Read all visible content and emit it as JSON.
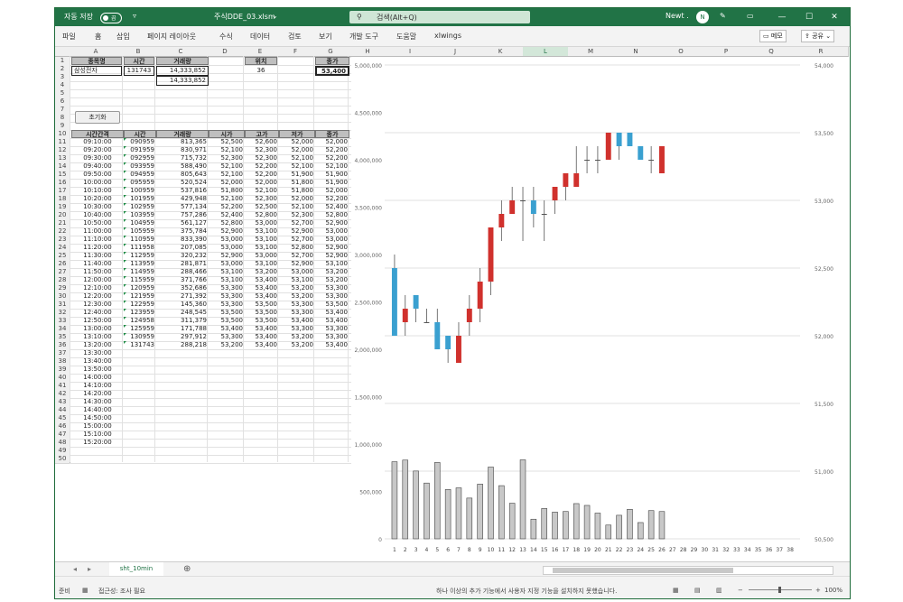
{
  "titlebar": {
    "autosave_label": "자동 저장",
    "autosave_state": "끔",
    "quick_access": "▿",
    "filename": "주식DDE_03.xlsm",
    "search_placeholder": "검색(Alt+Q)",
    "user_name": "Newt .",
    "user_initial": "N",
    "minimize": "—",
    "maximize": "☐",
    "close": "✕"
  },
  "ribbon": {
    "tabs": [
      "파일",
      "홈",
      "삽입",
      "페이지 레이아웃",
      "수식",
      "데이터",
      "검토",
      "보기",
      "개발 도구",
      "도움말",
      "xlwings"
    ],
    "memo": "메모",
    "share": "공유"
  },
  "columns": [
    "A",
    "B",
    "C",
    "D",
    "E",
    "F",
    "G",
    "H",
    "I",
    "J",
    "K",
    "L",
    "M",
    "N",
    "O",
    "P",
    "Q",
    "R"
  ],
  "selected_column": "L",
  "rows": {
    "numbers": [
      1,
      2,
      3,
      4,
      5,
      6,
      7,
      8,
      9,
      10,
      11,
      12,
      13,
      14,
      15,
      16,
      17,
      18,
      19,
      20,
      21,
      22,
      23,
      24,
      25,
      26,
      27,
      28,
      29,
      30,
      31,
      32,
      33,
      34,
      35,
      36,
      37,
      38,
      39,
      40,
      41,
      42,
      43,
      44,
      45,
      46,
      47,
      48,
      49,
      50
    ]
  },
  "top_section": {
    "headers": [
      "종목명",
      "시간",
      "거래량"
    ],
    "stock_name": "삼성전자",
    "time": "131743",
    "volume": "14,333,852",
    "volume2": "14,333,852",
    "position_label": "위치",
    "position_value": "36",
    "close_label": "종가",
    "close_value": "53,400"
  },
  "reset_button": "초기화",
  "table": {
    "headers": [
      "시간간격",
      "시간",
      "거래량",
      "시가",
      "고가",
      "저가",
      "종가"
    ],
    "rows": [
      [
        "09:10:00",
        "090959",
        "813,365",
        "52,500",
        "52,600",
        "52,000",
        "52,000"
      ],
      [
        "09:20:00",
        "091959",
        "830,971",
        "52,100",
        "52,300",
        "52,000",
        "52,200"
      ],
      [
        "09:30:00",
        "092959",
        "715,732",
        "52,300",
        "52,300",
        "52,100",
        "52,200"
      ],
      [
        "09:40:00",
        "093959",
        "588,490",
        "52,100",
        "52,200",
        "52,100",
        "52,100"
      ],
      [
        "09:50:00",
        "094959",
        "805,643",
        "52,100",
        "52,200",
        "51,900",
        "51,900"
      ],
      [
        "10:00:00",
        "095959",
        "520,524",
        "52,000",
        "52,000",
        "51,800",
        "51,900"
      ],
      [
        "10:10:00",
        "100959",
        "537,816",
        "51,800",
        "52,100",
        "51,800",
        "52,000"
      ],
      [
        "10:20:00",
        "101959",
        "429,948",
        "52,100",
        "52,300",
        "52,000",
        "52,200"
      ],
      [
        "10:30:00",
        "102959",
        "577,134",
        "52,200",
        "52,500",
        "52,100",
        "52,400"
      ],
      [
        "10:40:00",
        "103959",
        "757,286",
        "52,400",
        "52,800",
        "52,300",
        "52,800"
      ],
      [
        "10:50:00",
        "104959",
        "561,127",
        "52,800",
        "53,000",
        "52,700",
        "52,900"
      ],
      [
        "11:00:00",
        "105959",
        "375,784",
        "52,900",
        "53,100",
        "52,900",
        "53,000"
      ],
      [
        "11:10:00",
        "110959",
        "833,390",
        "53,000",
        "53,100",
        "52,700",
        "53,000"
      ],
      [
        "11:20:00",
        "111958",
        "207,085",
        "53,000",
        "53,100",
        "52,800",
        "52,900"
      ],
      [
        "11:30:00",
        "112959",
        "320,232",
        "52,900",
        "53,000",
        "52,700",
        "52,900"
      ],
      [
        "11:40:00",
        "113959",
        "281,871",
        "53,000",
        "53,100",
        "52,900",
        "53,100"
      ],
      [
        "11:50:00",
        "114959",
        "288,466",
        "53,100",
        "53,200",
        "53,000",
        "53,200"
      ],
      [
        "12:00:00",
        "115959",
        "371,766",
        "53,100",
        "53,400",
        "53,100",
        "53,200"
      ],
      [
        "12:10:00",
        "120959",
        "352,686",
        "53,300",
        "53,400",
        "53,200",
        "53,300"
      ],
      [
        "12:20:00",
        "121959",
        "271,392",
        "53,300",
        "53,400",
        "53,200",
        "53,300"
      ],
      [
        "12:30:00",
        "122959",
        "145,360",
        "53,300",
        "53,500",
        "53,300",
        "53,500"
      ],
      [
        "12:40:00",
        "123959",
        "248,545",
        "53,500",
        "53,500",
        "53,300",
        "53,400"
      ],
      [
        "12:50:00",
        "124958",
        "311,379",
        "53,500",
        "53,500",
        "53,400",
        "53,400"
      ],
      [
        "13:00:00",
        "125959",
        "171,788",
        "53,400",
        "53,400",
        "53,300",
        "53,300"
      ],
      [
        "13:10:00",
        "130959",
        "297,912",
        "53,300",
        "53,400",
        "53,200",
        "53,300"
      ],
      [
        "13:20:00",
        "131743",
        "288,218",
        "53,200",
        "53,400",
        "53,200",
        "53,400"
      ]
    ],
    "empty_times": [
      "13:30:00",
      "13:40:00",
      "13:50:00",
      "14:00:00",
      "14:10:00",
      "14:20:00",
      "14:30:00",
      "14:40:00",
      "14:50:00",
      "15:00:00",
      "15:10:00",
      "15:20:00"
    ]
  },
  "chart_data": {
    "type": "bar",
    "categories": [
      "1",
      "2",
      "3",
      "4",
      "5",
      "6",
      "7",
      "8",
      "9",
      "10",
      "11",
      "12",
      "13",
      "14",
      "15",
      "16",
      "17",
      "18",
      "19",
      "20",
      "21",
      "22",
      "23",
      "24",
      "25",
      "26",
      "27",
      "28",
      "29",
      "30",
      "31",
      "32",
      "33",
      "34",
      "35",
      "36",
      "37",
      "38"
    ],
    "candles": [
      {
        "open": 52500,
        "high": 52600,
        "low": 52000,
        "close": 52000
      },
      {
        "open": 52100,
        "high": 52300,
        "low": 52000,
        "close": 52200
      },
      {
        "open": 52300,
        "high": 52300,
        "low": 52100,
        "close": 52200
      },
      {
        "open": 52100,
        "high": 52200,
        "low": 52100,
        "close": 52100
      },
      {
        "open": 52100,
        "high": 52200,
        "low": 51900,
        "close": 51900
      },
      {
        "open": 52000,
        "high": 52000,
        "low": 51800,
        "close": 51900
      },
      {
        "open": 51800,
        "high": 52100,
        "low": 51800,
        "close": 52000
      },
      {
        "open": 52100,
        "high": 52300,
        "low": 52000,
        "close": 52200
      },
      {
        "open": 52200,
        "high": 52500,
        "low": 52100,
        "close": 52400
      },
      {
        "open": 52400,
        "high": 52800,
        "low": 52300,
        "close": 52800
      },
      {
        "open": 52800,
        "high": 53000,
        "low": 52700,
        "close": 52900
      },
      {
        "open": 52900,
        "high": 53100,
        "low": 52900,
        "close": 53000
      },
      {
        "open": 53000,
        "high": 53100,
        "low": 52700,
        "close": 53000
      },
      {
        "open": 53000,
        "high": 53100,
        "low": 52800,
        "close": 52900
      },
      {
        "open": 52900,
        "high": 53000,
        "low": 52700,
        "close": 52900
      },
      {
        "open": 53000,
        "high": 53100,
        "low": 52900,
        "close": 53100
      },
      {
        "open": 53100,
        "high": 53200,
        "low": 53000,
        "close": 53200
      },
      {
        "open": 53100,
        "high": 53400,
        "low": 53100,
        "close": 53200
      },
      {
        "open": 53300,
        "high": 53400,
        "low": 53200,
        "close": 53300
      },
      {
        "open": 53300,
        "high": 53400,
        "low": 53200,
        "close": 53300
      },
      {
        "open": 53300,
        "high": 53500,
        "low": 53300,
        "close": 53500
      },
      {
        "open": 53500,
        "high": 53500,
        "low": 53300,
        "close": 53400
      },
      {
        "open": 53500,
        "high": 53500,
        "low": 53400,
        "close": 53400
      },
      {
        "open": 53400,
        "high": 53400,
        "low": 53300,
        "close": 53300
      },
      {
        "open": 53300,
        "high": 53400,
        "low": 53200,
        "close": 53300
      },
      {
        "open": 53200,
        "high": 53400,
        "low": 53200,
        "close": 53400
      }
    ],
    "volumes": [
      813365,
      830971,
      715732,
      588490,
      805643,
      520524,
      537816,
      429948,
      577134,
      757286,
      561127,
      375784,
      833390,
      207085,
      320232,
      281871,
      288466,
      371766,
      352686,
      271392,
      145360,
      248545,
      311379,
      171788,
      297912,
      288218
    ],
    "left_axis": {
      "ticks": [
        0,
        500000,
        1000000,
        1500000,
        2000000,
        2500000,
        3000000,
        3500000,
        4000000,
        4500000,
        5000000
      ],
      "labels": [
        "0",
        "500,000",
        "1,000,000",
        "1,500,000",
        "2,000,000",
        "2,500,000",
        "3,000,000",
        "3,500,000",
        "4,000,000",
        "4,500,000",
        "5,000,000"
      ],
      "ylim": [
        0,
        5000000
      ]
    },
    "right_axis": {
      "ticks": [
        50500,
        51000,
        51500,
        52000,
        52500,
        53000,
        53500,
        54000
      ],
      "labels": [
        "50,500",
        "51,000",
        "51,500",
        "52,000",
        "52,500",
        "53,000",
        "53,500",
        "54,000"
      ],
      "ylim": [
        50500,
        54000
      ]
    },
    "up_color": "#d0312d",
    "down_color": "#3aa0d0",
    "volume_color": "#c8c8c8",
    "grid": true
  },
  "sheet": {
    "tab": "sht_10min",
    "add": "⊕"
  },
  "status": {
    "ready": "준비",
    "accessibility": "접근성: 조사 필요",
    "info": "하나 이상의 추가 기능에서 사용자 지정 기능을 설치하지 못했습니다.",
    "zoom": "100%"
  },
  "colors": {
    "accent": "#217346"
  }
}
